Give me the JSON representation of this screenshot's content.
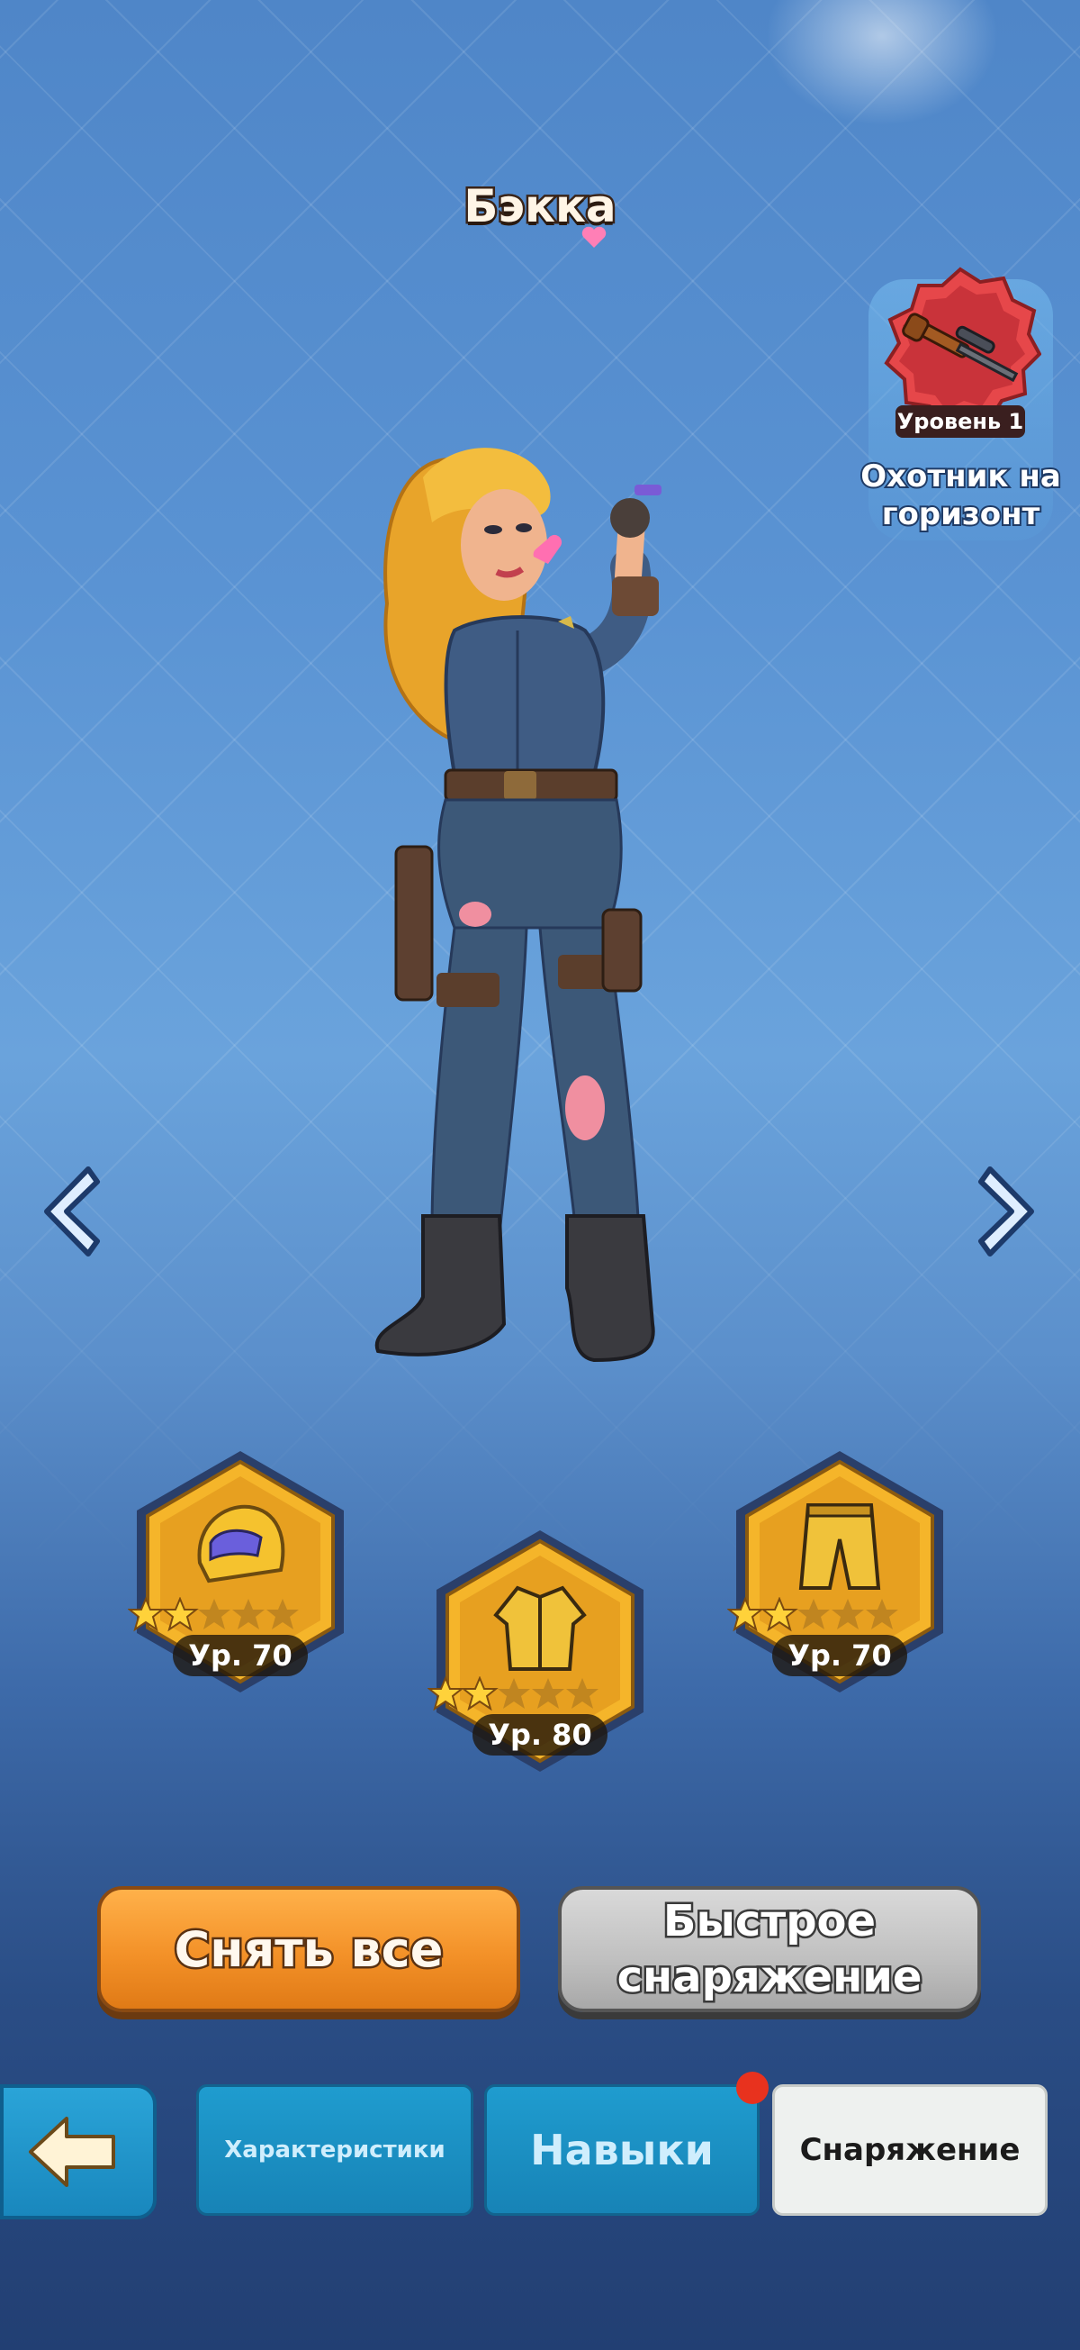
{
  "hero": {
    "name": "Бэкка"
  },
  "skill": {
    "level_label": "Уровень 1",
    "name": "Охотник на горизонт"
  },
  "equipment": [
    {
      "slot": "helmet",
      "icon": "helmet-icon",
      "level_label": "Ур. 70",
      "stars_filled": 2,
      "stars_total": 5
    },
    {
      "slot": "jacket",
      "icon": "jacket-icon",
      "level_label": "Ур. 80",
      "stars_filled": 2,
      "stars_total": 5
    },
    {
      "slot": "pants",
      "icon": "pants-icon",
      "level_label": "Ур. 70",
      "stars_filled": 2,
      "stars_total": 5
    }
  ],
  "actions": {
    "unequip_all": "Снять все",
    "quick_equip": "Быстрое снаряжение"
  },
  "tabs": {
    "stats": "Характеристики",
    "skills": "Навыки",
    "gear": "Снаряжение",
    "active": "gear",
    "skills_has_notification": true
  },
  "colors": {
    "accent_orange": "#f39128",
    "tab_blue": "#1f9ccf",
    "slot_gold": "#f5b52a",
    "notification": "#e8321e"
  }
}
